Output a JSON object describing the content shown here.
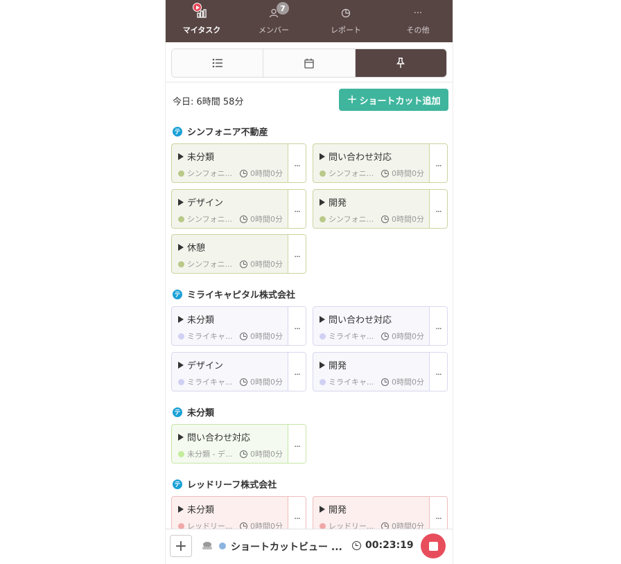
{
  "nav": {
    "items": [
      {
        "label": "マイタスク",
        "icon": "chart-icon",
        "active": true
      },
      {
        "label": "メンバー",
        "icon": "person-icon",
        "badge": "7"
      },
      {
        "label": "レポート",
        "icon": "pie-chart-icon"
      },
      {
        "label": "その他",
        "icon": "more-horizontal-icon",
        "glyph": "···"
      }
    ]
  },
  "view_tabs": [
    "list-view-icon",
    "calendar-icon",
    "pin-icon"
  ],
  "today": "今日: 6時間 58分",
  "add_shortcut": "ショートカット追加",
  "add_shortcut_plus": "+",
  "team_badge": "テ",
  "card_time": "0時間0分",
  "more": "...",
  "groups": [
    {
      "title": "シンフォニア不動産",
      "cards": [
        {
          "title": "未分類",
          "project": "シンフォニ..."
        },
        {
          "title": "問い合わせ対応",
          "project": "シンフォニ..."
        },
        {
          "title": "デザイン",
          "project": "シンフォニ..."
        },
        {
          "title": "開発",
          "project": "シンフォニ..."
        },
        {
          "title": "休憩",
          "project": "シンフォニ..."
        }
      ]
    },
    {
      "title": "ミライキャピタル株式会社",
      "cards": [
        {
          "title": "未分類",
          "project": "ミライキャ..."
        },
        {
          "title": "問い合わせ対応",
          "project": "ミライキャ..."
        },
        {
          "title": "デザイン",
          "project": "ミライキャ..."
        },
        {
          "title": "開発",
          "project": "ミライキャ..."
        }
      ]
    },
    {
      "title": "未分類",
      "cards": [
        {
          "title": "問い合わせ対応",
          "project": "未分類 - デ..."
        }
      ]
    },
    {
      "title": "レッドリーフ株式会社",
      "cards": [
        {
          "title": "未分類",
          "project": "レッドリー..."
        },
        {
          "title": "開発",
          "project": "レッドリー..."
        }
      ]
    }
  ],
  "bottom": {
    "add": "+",
    "title": "ショートカットビュー ...",
    "timer": "00:23:19"
  },
  "colors": {
    "nav_bg": "#574544",
    "accent_green": "#3fb59d",
    "stop_red": "#e84d5c",
    "team_blue": "#1aa0d6"
  }
}
